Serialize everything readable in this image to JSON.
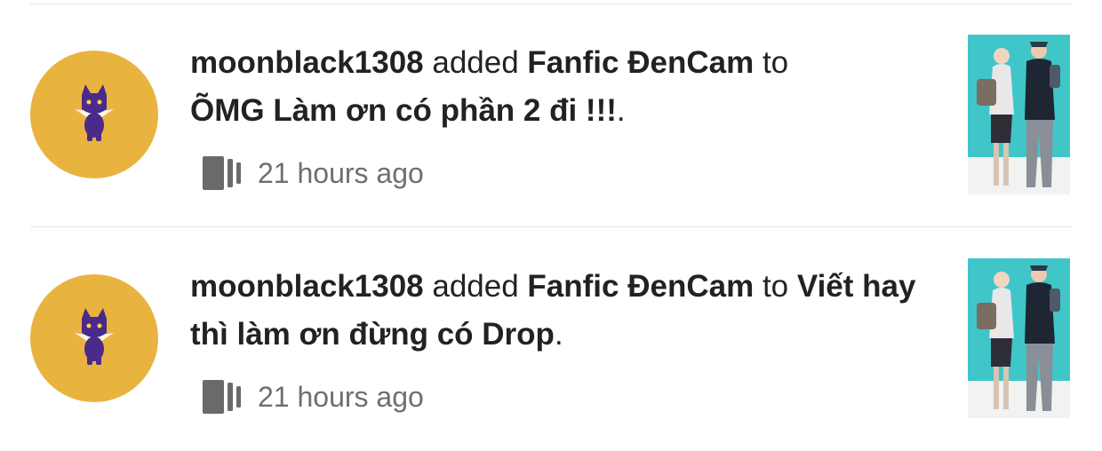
{
  "feed": {
    "items": [
      {
        "user": "moonblack1308",
        "action": "added",
        "story": "Fanfic ĐenCam",
        "connector": "to",
        "list": "ÕMG Làm ơn có phần 2 đi !!!",
        "end": ".",
        "time": "21 hours ago",
        "icons": {
          "avatar": "purple-cat-avatar",
          "meta": "reading-list-icon",
          "cover": "story-cover-two-people"
        }
      },
      {
        "user": "moonblack1308",
        "action": "added",
        "story": "Fanfic ĐenCam",
        "connector": "to",
        "list": "Viết hay thì làm ơn đừng có Drop",
        "end": ".",
        "time": "21 hours ago",
        "icons": {
          "avatar": "purple-cat-avatar",
          "meta": "reading-list-icon",
          "cover": "story-cover-two-people"
        }
      }
    ]
  },
  "colors": {
    "avatar_bg": "#e9b33f",
    "cat": "#4a2a8a",
    "cover_bg": "#40c6c9",
    "meta_text": "#6f6f6f",
    "text": "#222222"
  }
}
